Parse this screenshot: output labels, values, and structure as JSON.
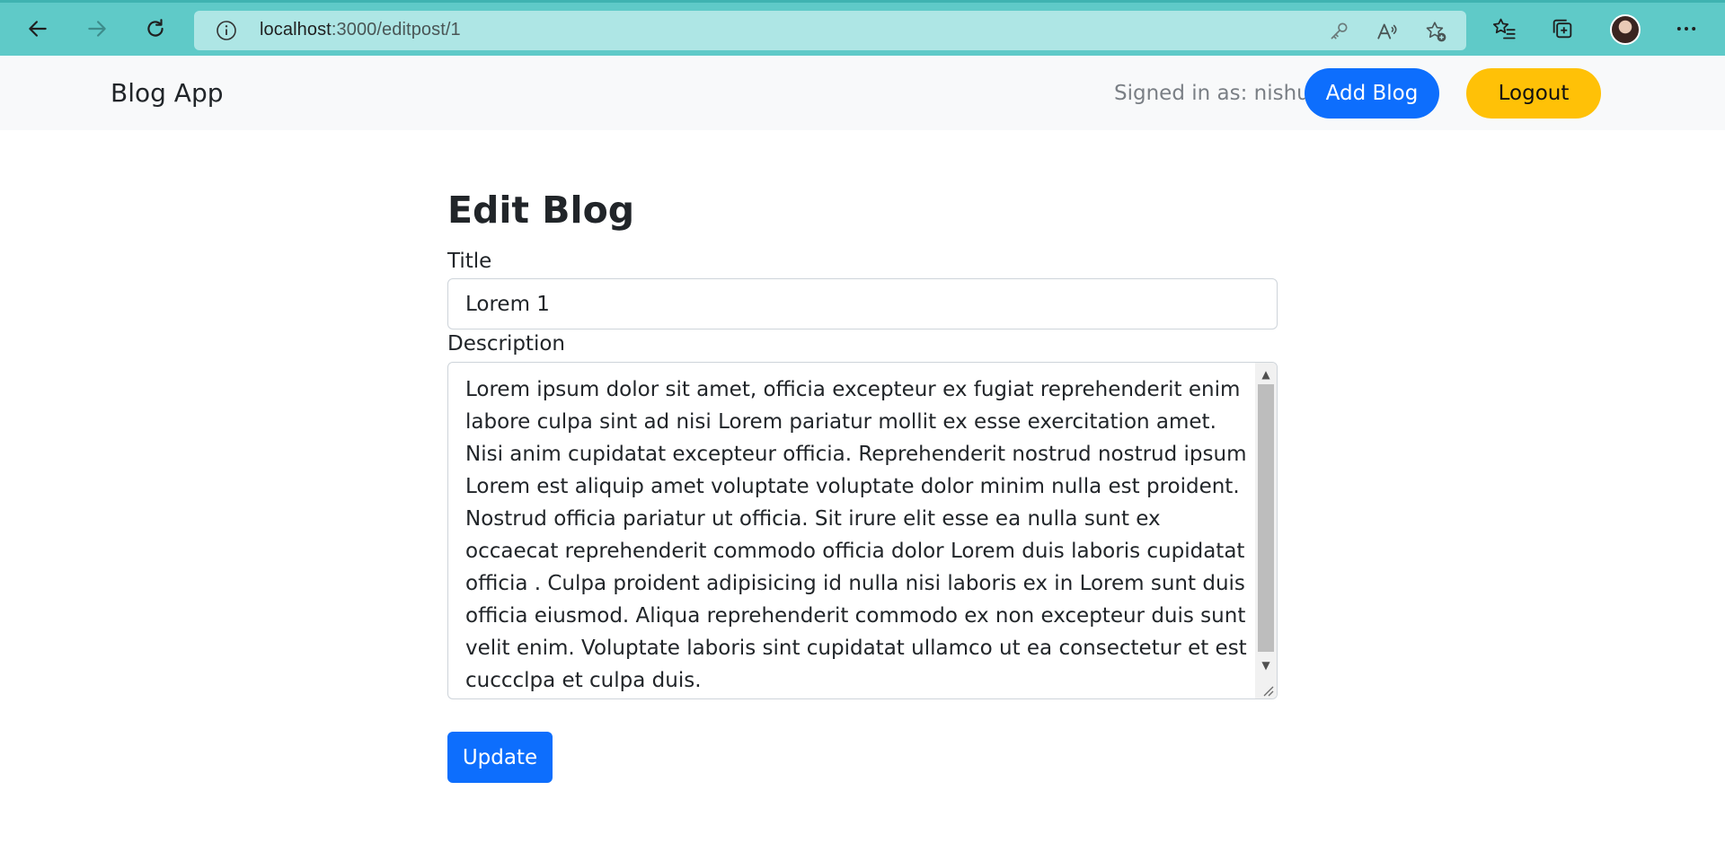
{
  "browser": {
    "url_host": "localhost",
    "url_path": ":3000/editpost/1",
    "accent": "#5fcac8"
  },
  "navbar": {
    "brand": "Blog App",
    "signed_in": "Signed in as: nishu",
    "add_blog": "Add Blog",
    "logout": "Logout"
  },
  "form": {
    "heading": "Edit Blog",
    "title_label": "Title",
    "title_value": "Lorem 1",
    "description_label": "Description",
    "description_value": "Lorem ipsum dolor sit amet, officia excepteur ex fugiat reprehenderit enim labore culpa sint ad nisi Lorem pariatur mollit ex esse exercitation amet. Nisi anim cupidatat excepteur officia. Reprehenderit nostrud nostrud ipsum Lorem est aliquip amet voluptate voluptate dolor minim nulla est proident. Nostrud officia pariatur ut officia. Sit irure elit esse ea nulla sunt ex occaecat reprehenderit commodo officia dolor Lorem duis laboris cupidatat officia . Culpa proident adipisicing id nulla nisi laboris ex in Lorem sunt duis officia eiusmod. Aliqua reprehenderit commodo ex non excepteur duis sunt velit enim. Voluptate laboris sint cupidatat ullamco ut ea consectetur et est cuccclpa et culpa duis.\nby nishussss",
    "update_label": "Update"
  },
  "colors": {
    "primary": "#0d6efd",
    "warning": "#ffc107",
    "navbar_bg": "#f8f9fa"
  }
}
